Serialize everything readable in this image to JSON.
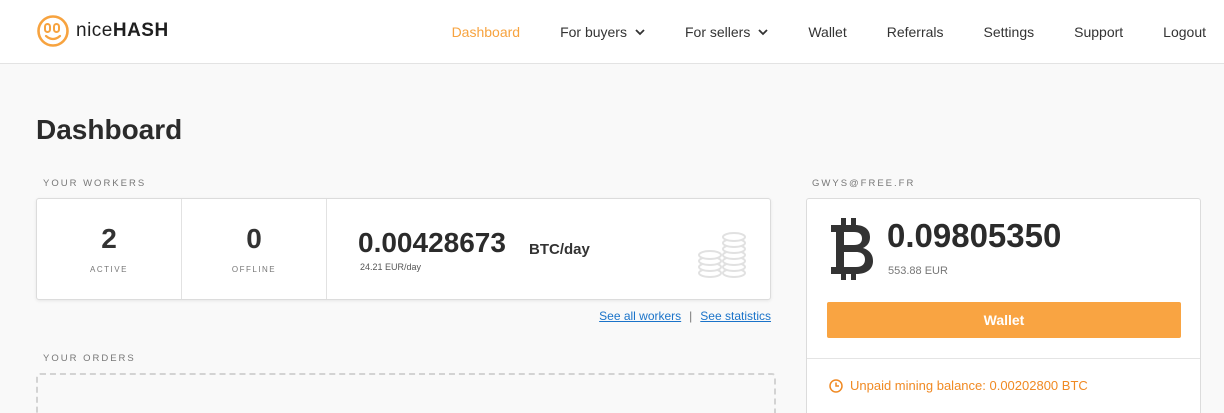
{
  "logo": {
    "text_light": "nice",
    "text_bold": "HASH"
  },
  "nav": {
    "dashboard": "Dashboard",
    "for_buyers": "For buyers",
    "for_sellers": "For sellers",
    "wallet": "Wallet",
    "referrals": "Referrals",
    "settings": "Settings",
    "support": "Support",
    "logout": "Logout"
  },
  "page_title": "Dashboard",
  "workers": {
    "section_label": "YOUR WORKERS",
    "active_count": "2",
    "active_label": "ACTIVE",
    "offline_count": "0",
    "offline_label": "OFFLINE",
    "profitability": "0.00428673",
    "profitability_unit": "BTC/day",
    "profitability_eur": "24.21 EUR/day",
    "see_all_workers": "See all workers",
    "separator": "|",
    "see_statistics": "See statistics"
  },
  "orders": {
    "section_label": "YOUR ORDERS"
  },
  "account": {
    "email_label": "GWYS@FREE.FR",
    "balance_btc": "0.09805350",
    "balance_eur": "553.88 EUR",
    "wallet_button": "Wallet",
    "unpaid_balance": "Unpaid mining balance: 0.00202800 BTC"
  },
  "colors": {
    "accent": "#f7a33f",
    "button": "#f9a442",
    "link": "#1a73c9",
    "unpaid": "#f08a24"
  },
  "icons": {
    "logo": "nicehash-smiley-icon",
    "dropdown": "chevron-down-icon",
    "coins": "coins-stack-icon",
    "bitcoin": "bitcoin-icon",
    "clock": "clock-icon"
  }
}
